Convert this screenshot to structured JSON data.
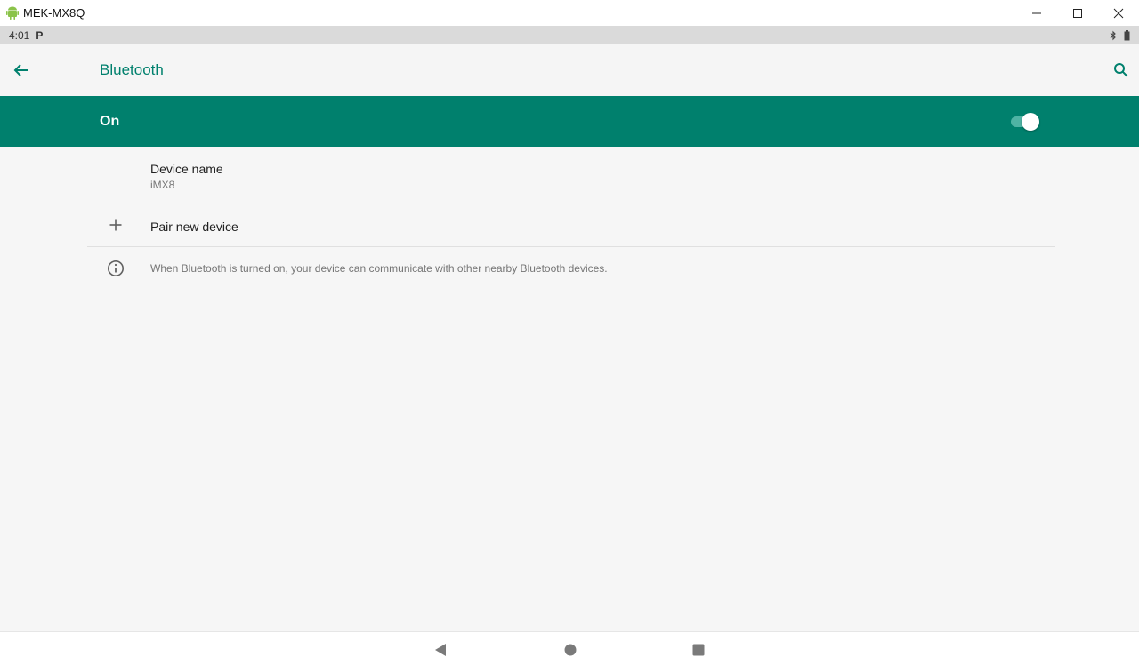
{
  "window": {
    "title": "MEK-MX8Q",
    "icons": {
      "app": "android-icon",
      "minimize": "minimize-icon",
      "maximize": "maximize-icon",
      "close": "close-icon"
    }
  },
  "status_bar": {
    "time": "4:01",
    "left_glyph": "P",
    "icons": [
      "bluetooth-icon",
      "battery-icon"
    ]
  },
  "app_bar": {
    "title": "Bluetooth",
    "icons": {
      "back": "arrow-back-icon",
      "search": "search-icon"
    }
  },
  "master_switch": {
    "label": "On",
    "checked": true
  },
  "preferences": {
    "device_name": {
      "title": "Device name",
      "summary": "iMX8"
    },
    "pair_new": {
      "title": "Pair new device",
      "icon": "plus-icon"
    },
    "info": {
      "text": "When Bluetooth is turned on, your device can communicate with other nearby Bluetooth devices.",
      "icon": "info-icon"
    }
  },
  "nav_bar": {
    "icons": [
      "nav-back-icon",
      "nav-home-icon",
      "nav-recents-icon"
    ]
  },
  "colors": {
    "accent": "#00806d",
    "switch_track": "#4fb3a4",
    "background": "#f6f6f6",
    "status_bar": "#dadada"
  }
}
